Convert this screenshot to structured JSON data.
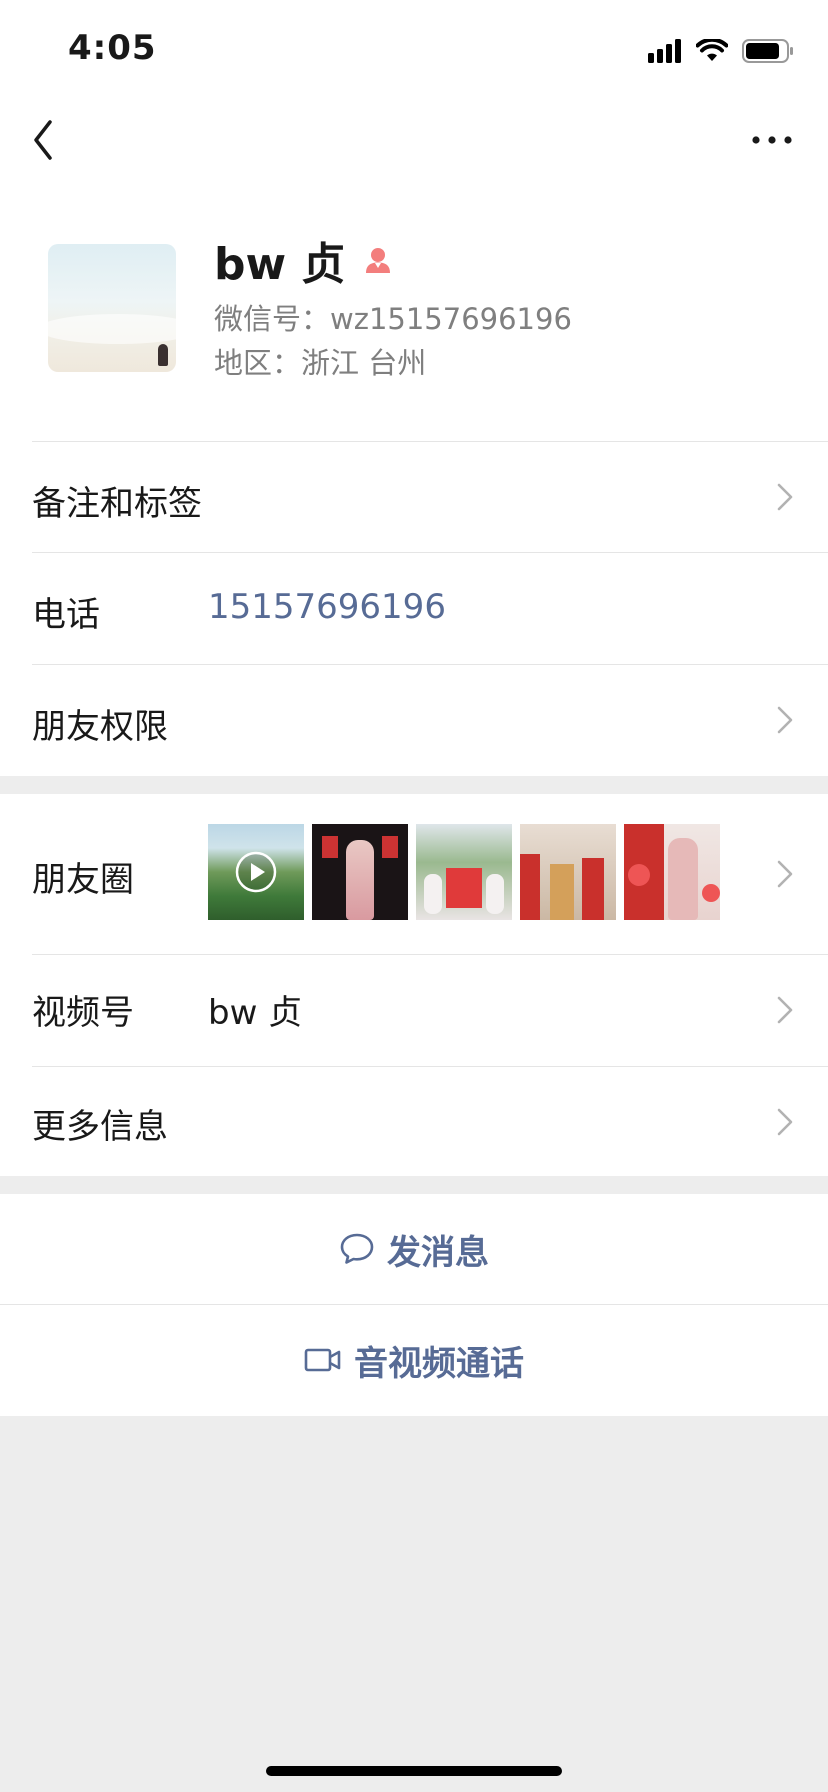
{
  "status": {
    "time": "4:05"
  },
  "profile": {
    "name": "bw 贞",
    "wechat_id": "微信号：wz15157696196",
    "region": "地区：浙江 台州"
  },
  "rows": {
    "remarks": {
      "label": "备注和标签"
    },
    "phone": {
      "label": "电话",
      "value": "15157696196"
    },
    "friend_permissions": {
      "label": "朋友权限"
    },
    "moments": {
      "label": "朋友圈",
      "thumbnail_count": 5
    },
    "channels": {
      "label": "视频号",
      "value": "bw 贞"
    },
    "more_info": {
      "label": "更多信息"
    }
  },
  "actions": {
    "send_message": "发消息",
    "video_call": "音视频通话"
  },
  "colors": {
    "link": "#576b95",
    "gender_icon": "#f37e7d",
    "secondary_text": "#7f7f7f",
    "background": "#ededed"
  },
  "icons": {
    "back": "chevron-left-icon",
    "more": "more-dots-icon",
    "gender": "female-icon",
    "chevron": "chevron-right-icon",
    "message": "chat-bubble-icon",
    "video": "video-camera-icon"
  }
}
